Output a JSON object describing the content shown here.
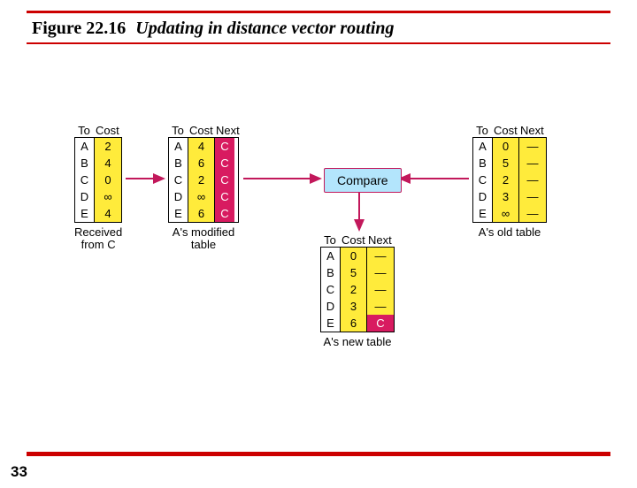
{
  "figure": {
    "number": "Figure 22.16",
    "caption": "Updating in distance vector routing"
  },
  "page": "33",
  "labels": {
    "to": "To",
    "cost": "Cost",
    "next": "Next",
    "compare": "Compare"
  },
  "tables": {
    "received": {
      "caption1": "Received",
      "caption2": "from C",
      "rows": [
        {
          "to": "A",
          "cost": "2"
        },
        {
          "to": "B",
          "cost": "4"
        },
        {
          "to": "C",
          "cost": "0"
        },
        {
          "to": "D",
          "cost": "∞"
        },
        {
          "to": "E",
          "cost": "4"
        }
      ]
    },
    "modified": {
      "caption1": "A's modified",
      "caption2": "table",
      "rows": [
        {
          "to": "A",
          "cost": "4",
          "next": "C"
        },
        {
          "to": "B",
          "cost": "6",
          "next": "C"
        },
        {
          "to": "C",
          "cost": "2",
          "next": "C"
        },
        {
          "to": "D",
          "cost": "∞",
          "next": "C"
        },
        {
          "to": "E",
          "cost": "6",
          "next": "C"
        }
      ]
    },
    "old": {
      "caption1": "A's old table",
      "rows": [
        {
          "to": "A",
          "cost": "0",
          "next": "—"
        },
        {
          "to": "B",
          "cost": "5",
          "next": "—"
        },
        {
          "to": "C",
          "cost": "2",
          "next": "—"
        },
        {
          "to": "D",
          "cost": "3",
          "next": "—"
        },
        {
          "to": "E",
          "cost": "∞",
          "next": "—"
        }
      ]
    },
    "new": {
      "caption1": "A's new table",
      "rows": [
        {
          "to": "A",
          "cost": "0",
          "next": "—"
        },
        {
          "to": "B",
          "cost": "5",
          "next": "—"
        },
        {
          "to": "C",
          "cost": "2",
          "next": "—"
        },
        {
          "to": "D",
          "cost": "3",
          "next": "—"
        },
        {
          "to": "E",
          "cost": "6",
          "next": "C"
        }
      ]
    }
  }
}
